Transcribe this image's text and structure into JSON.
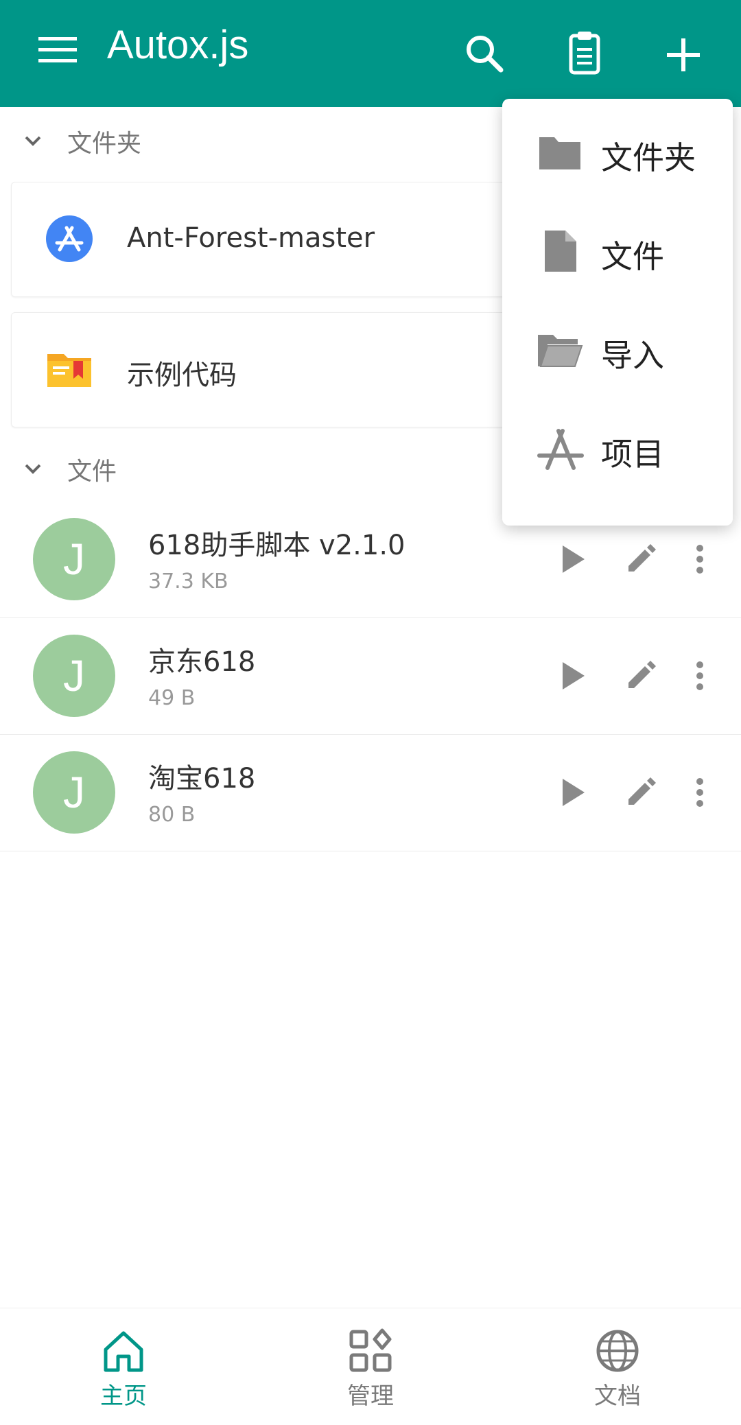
{
  "app": {
    "title": "Autox.js"
  },
  "colors": {
    "primary": "#009688",
    "avatar": "#9ccc9c",
    "icon_gray": "#8a8a8a",
    "inactive": "#7a7a7a"
  },
  "toolbar": {
    "icons": [
      "menu-icon",
      "search-icon",
      "clipboard-icon",
      "add-icon"
    ]
  },
  "sections": {
    "folders": {
      "label": "文件夹",
      "items": [
        {
          "name": "Ant-Forest-master",
          "icon": "app-store-icon"
        },
        {
          "name": "示例代码",
          "icon": "folder-bookmark-icon"
        }
      ]
    },
    "files": {
      "label": "文件",
      "items": [
        {
          "avatar": "J",
          "name": "618助手脚本 v2.1.0",
          "size": "37.3 KB"
        },
        {
          "avatar": "J",
          "name": "京东618",
          "size": "49 B"
        },
        {
          "avatar": "J",
          "name": "淘宝618",
          "size": "80 B"
        }
      ]
    }
  },
  "popup_menu": {
    "items": [
      {
        "label": "文件夹",
        "icon": "folder-icon"
      },
      {
        "label": "文件",
        "icon": "file-icon"
      },
      {
        "label": "导入",
        "icon": "folder-open-icon"
      },
      {
        "label": "项目",
        "icon": "project-icon"
      }
    ]
  },
  "bottom_nav": {
    "tabs": [
      {
        "label": "主页",
        "icon": "home-icon",
        "active": true
      },
      {
        "label": "管理",
        "icon": "grid-icon",
        "active": false
      },
      {
        "label": "文档",
        "icon": "globe-icon",
        "active": false
      }
    ]
  }
}
